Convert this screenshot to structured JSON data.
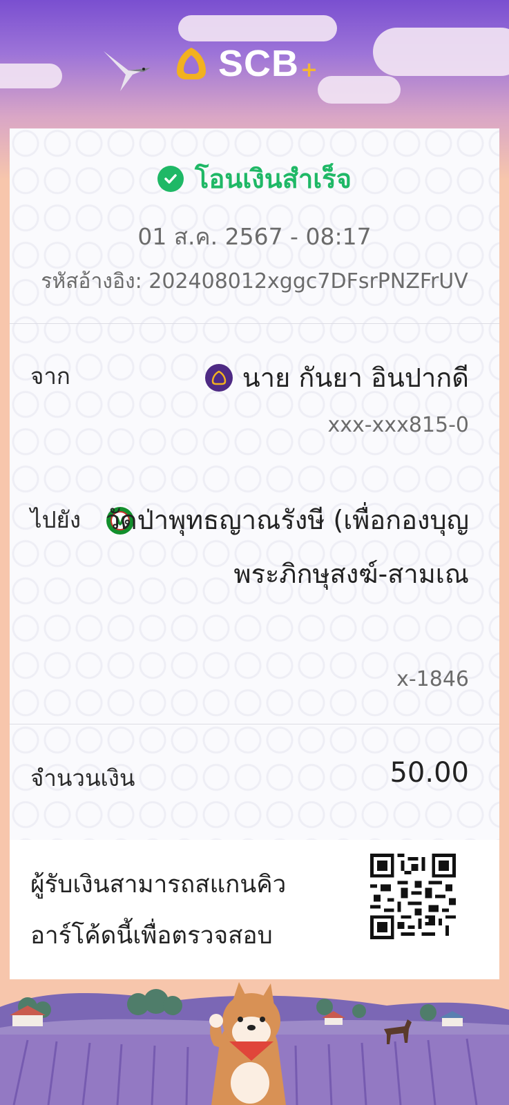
{
  "header": {
    "brand": "SCB",
    "brand_plus": "+"
  },
  "status": {
    "title": "โอนเงินสำเร็จ",
    "datetime": "01 ส.ค. 2567 - 08:17",
    "reference_label": "รหัสอ้างอิง:",
    "reference": "202408012xggc7DFsrPNZFrUV"
  },
  "from": {
    "label": "จาก",
    "name": "นาย กันยา อินปากดี",
    "account": "xxx-xxx815-0"
  },
  "to": {
    "label": "ไปยัง",
    "name": "วัดป่าพุทธญาณรังษี (เพื่อกองบุญ พระภิกษุสงฆ์-สามเณ",
    "account": "x-1846"
  },
  "amount": {
    "label": "จำนวนเงิน",
    "value": "50.00"
  },
  "qr": {
    "text_line1": "ผู้รับเงินสามารถสแกนคิว",
    "text_line2": "อาร์โค้ดนี้เพื่อตรวจสอบ"
  },
  "colors": {
    "success": "#1fb866",
    "scb_purple": "#4e2a84",
    "kbank_green": "#138f2d"
  },
  "icons": [
    "scb-logo-icon",
    "bird-icon",
    "check-circle-icon",
    "scb-bank-icon",
    "kbank-icon",
    "qr-code-icon",
    "shiba-dog-illustration"
  ]
}
